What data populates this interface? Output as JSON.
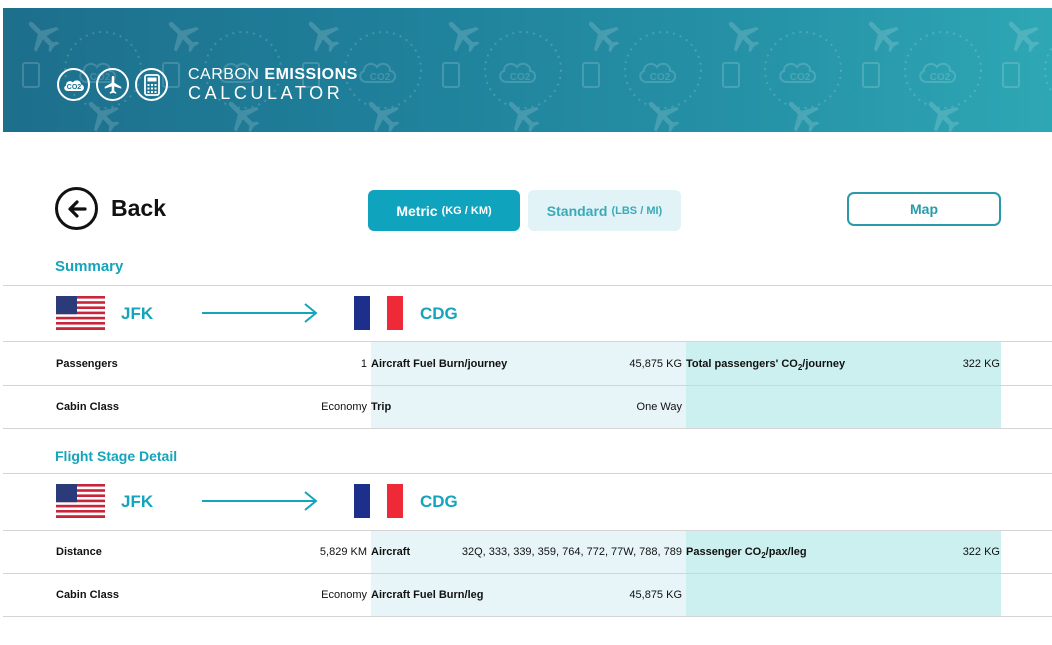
{
  "header": {
    "brand_light": "CARBON",
    "brand_bold": "EMISSIONS",
    "brand_line2": "CALCULATOR",
    "icons": [
      "co2-cloud-icon",
      "airplane-icon",
      "calculator-icon"
    ],
    "pattern_co2_text": "CO2",
    "colors": {
      "banner_start": "#1d6f8c",
      "banner_end": "#2ea7b4"
    }
  },
  "nav": {
    "back_label": "Back",
    "metric_label": "Metric",
    "metric_units": "(KG / KM)",
    "standard_label": "Standard",
    "standard_units": "(LBS / MI)",
    "map_label": "Map",
    "accent": "#10a3bd"
  },
  "summary": {
    "title": "Summary",
    "origin": "JFK",
    "destination": "CDG",
    "rows": [
      {
        "c1_label": "Passengers",
        "c1_value": "1",
        "c2_label": "Aircraft Fuel Burn/journey",
        "c2_value": "45,875 KG",
        "c3_label_pre": "Total passengers' CO",
        "c3_label_sub": "2",
        "c3_label_post": "/journey",
        "c3_value": "322 KG"
      },
      {
        "c1_label": "Cabin Class",
        "c1_value": "Economy",
        "c2_label": "Trip",
        "c2_value": "One Way"
      }
    ]
  },
  "stage": {
    "title": "Flight Stage Detail",
    "origin": "JFK",
    "destination": "CDG",
    "rows": [
      {
        "c1_label": "Distance",
        "c1_value": "5,829 KM",
        "c2_label": "Aircraft",
        "c2_value": "32Q, 333, 339, 359, 764, 772, 77W, 788, 789",
        "c3_label_pre": "Passenger CO",
        "c3_label_sub": "2",
        "c3_label_post": "/pax/leg",
        "c3_value": "322 KG"
      },
      {
        "c1_label": "Cabin Class",
        "c1_value": "Economy",
        "c2_label": "Aircraft Fuel Burn/leg",
        "c2_value": "45,875 KG"
      }
    ]
  }
}
